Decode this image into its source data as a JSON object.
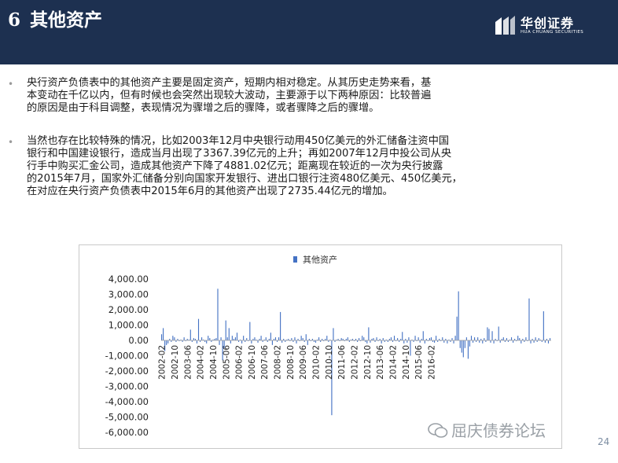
{
  "header": {
    "number": "6",
    "title": "其他资产"
  },
  "logo": {
    "cn": "华创证券",
    "en": "HUA CHUANG SECURITIES"
  },
  "bullets": [
    {
      "lines": [
        "央行资产负债表中的其他资产主要是固定资产，短期内相对稳定。从其历史走势来看，基",
        "本变动在千亿以内，但有时候也会突然出现较大波动，主要源于以下两种原因：比较普遍",
        "的原因是由于科目调整，表现情况为骤增之后的骤降，或者骤降之后的骤增。"
      ]
    },
    {
      "lines": [
        "当然也存在比较特殊的情况，比如2003年12月中央银行动用450亿美元的外汇储备注资中国",
        "银行和中国建设银行，造成当月出现了3367.39亿元的上升；再如2007年12月中投公司从央",
        "行手中购买汇金公司，造成其他资产下降了4881.02亿元；距离现在较近的一次为央行披露",
        "的2015年7月，国家外汇储备分别向国家开发银行、进出口银行注资480亿美元、450亿美元，",
        "在对应在央行资产负债表中2015年6月的其他资产出现了2735.44亿元的增加。"
      ]
    }
  ],
  "chart_data": {
    "type": "bar",
    "title": "",
    "legend": [
      "其他资产"
    ],
    "legend_position": "top",
    "ylim": [
      -6000,
      4000
    ],
    "yticks": [
      "4,000.00",
      "3,000.00",
      "2,000.00",
      "1,000.00",
      "0.00",
      "-1,000.00",
      "-2,000.00",
      "-3,000.00",
      "-4,000.00",
      "-5,000.00",
      "-6,000.00"
    ],
    "x_tick_labels": [
      "2002-02",
      "2002-10",
      "2003-06",
      "2004-02",
      "2004-10",
      "2005-06",
      "2006-02",
      "2006-10",
      "2007-06",
      "2008-02",
      "2008-10",
      "2009-06",
      "2010-02",
      "2010-10",
      "2011-06",
      "2012-02",
      "2012-10",
      "2013-06",
      "2014-02",
      "2014-10",
      "2015-06",
      "2016-02"
    ],
    "x_start": "2002-02",
    "x_end": "2016-02",
    "series": [
      {
        "name": "其他资产",
        "color": "#4472c4",
        "values": [
          400,
          800,
          -700,
          -300,
          -200,
          100,
          -100,
          300,
          200,
          -100,
          100,
          -50,
          50,
          -100,
          200,
          -50,
          100,
          50,
          700,
          -100,
          150,
          100,
          -200,
          1400,
          -100,
          200,
          50,
          -100,
          -200,
          300,
          150,
          -100,
          50,
          100,
          150,
          3367.39,
          -300,
          200,
          -1300,
          -500,
          1300,
          200,
          800,
          -200,
          300,
          100,
          200,
          500,
          -100,
          50,
          -200,
          300,
          -100,
          150,
          -50,
          1200,
          -200,
          100,
          200,
          50,
          -150,
          100,
          300,
          -100,
          50,
          200,
          -100,
          100,
          500,
          -300,
          100,
          200,
          -100,
          200,
          1850,
          -150,
          100,
          -100,
          50,
          100,
          -50,
          150,
          -100,
          200,
          -200,
          100,
          -50,
          300,
          150,
          -100,
          400,
          -300,
          100,
          -50,
          100,
          -100,
          -150,
          50,
          200,
          -100,
          100,
          -50,
          100,
          300,
          -100,
          50,
          -4881.02,
          800,
          -100,
          50,
          100,
          -50,
          150,
          100,
          -50,
          100,
          200,
          -100,
          50,
          100,
          -50,
          100,
          -100,
          150,
          -50,
          300,
          200,
          -100,
          -200,
          850,
          -150,
          100,
          150,
          -100,
          200,
          -50,
          100,
          -200,
          150,
          -100,
          50,
          -100,
          100,
          200,
          -100,
          300,
          -50,
          150,
          -100,
          100,
          550,
          -200,
          100,
          -150,
          200,
          -1000,
          50,
          -100,
          300,
          -50,
          200,
          -150,
          100,
          600,
          -200,
          100,
          -50,
          150,
          200,
          -100,
          -150,
          300,
          -100,
          100,
          -50,
          200,
          -150,
          100,
          -200,
          50,
          -100,
          150,
          -200,
          300,
          1550,
          3200,
          -500,
          -800,
          -1100,
          -500,
          200,
          -1200,
          -400,
          300,
          -150,
          200,
          -100,
          200,
          -150,
          100,
          -200,
          150,
          -100,
          850,
          750,
          -150,
          600,
          -200,
          100,
          -50,
          900,
          -150,
          100,
          200,
          -100,
          150,
          -100,
          50,
          200,
          -150,
          100,
          -50,
          300,
          150,
          -200,
          100,
          -100,
          200,
          -50,
          2735.44,
          -200,
          100,
          -150,
          200,
          -100,
          150,
          50,
          -100,
          1900,
          -150,
          100,
          -200,
          150
        ]
      }
    ]
  },
  "watermark": {
    "text": "屈庆债券论坛"
  },
  "page": {
    "number": "24"
  }
}
